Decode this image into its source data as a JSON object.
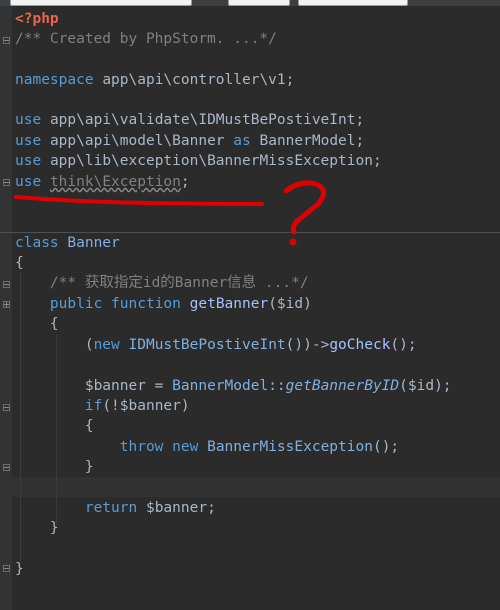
{
  "editor": {
    "lines": {
      "open_tag": "<?php",
      "header_comment": "/** Created by PhpStorm. ...*/",
      "namespace_kw": "namespace",
      "namespace_path": "app\\api\\controller\\v1;",
      "use_kw": "use",
      "use1_path": "app\\api\\validate\\IDMustBePostiveInt;",
      "use2_path": "app\\api\\model\\Banner",
      "use2_as": "as",
      "use2_alias": "BannerModel;",
      "use3_path": "app\\lib\\exception\\BannerMissException;",
      "use4_path": "think\\Exception",
      "use4_semicolon": ";",
      "class_kw": "class",
      "class_name": "Banner",
      "open_brace": "{",
      "close_brace": "}",
      "doc_comment": "/** 获取指定id的Banner信息 ...*/",
      "public_kw": "public",
      "function_kw": "function",
      "method_name": "getBanner",
      "method_params": "($id)",
      "new_kw": "new",
      "validate_class": "IDMustBePostiveInt",
      "validate_call_mid": "())->",
      "gocheck": "goCheck",
      "call_end": "();",
      "banner_assign": "$banner = ",
      "banner_model": "BannerModel",
      "static_op": "::",
      "static_method": "getBannerByID",
      "static_args": "($id);",
      "if_kw": "if",
      "if_cond": "(!$banner)",
      "throw_kw": "throw",
      "exception_class": "BannerMissException",
      "return_kw": "return",
      "return_val": "$banner;"
    }
  },
  "annotation": {
    "mark": "?",
    "color": "#e00000"
  }
}
